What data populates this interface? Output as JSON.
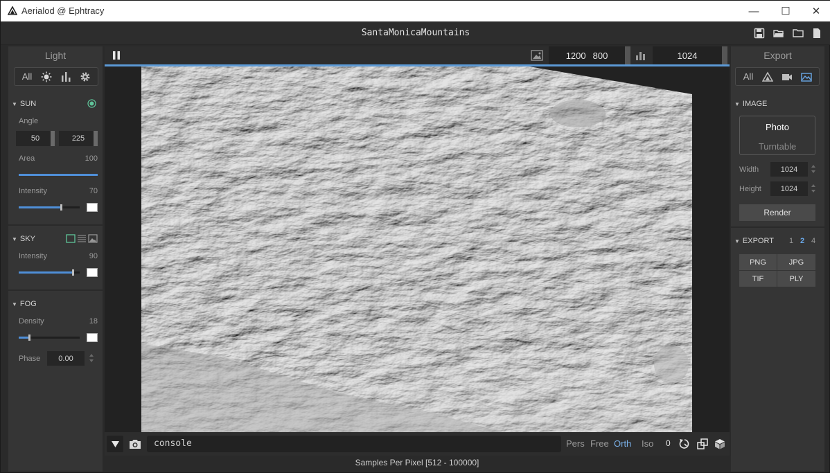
{
  "window": {
    "title": "Aerialod @ Ephtracy",
    "minimize_glyph": "—",
    "maximize_glyph": "☐",
    "close_glyph": "✕"
  },
  "app": {
    "document_title": "SantaMonicaMountains",
    "header_icons": [
      "save-icon",
      "open-folder-icon",
      "folder-icon",
      "file-icon"
    ]
  },
  "light_panel": {
    "title": "Light",
    "tabs": [
      {
        "label": "All",
        "icon": null
      },
      {
        "label": "",
        "icon": "sun-icon"
      },
      {
        "label": "",
        "icon": "bar-chart-icon"
      },
      {
        "label": "",
        "icon": "gear-icon"
      }
    ],
    "sun": {
      "header": "SUN",
      "angle_label": "Angle",
      "angle_a": "50",
      "angle_b": "225",
      "area_label": "Area",
      "area_value": "100",
      "area_fraction": 1.0,
      "intensity_label": "Intensity",
      "intensity_value": "70",
      "intensity_fraction": 0.7,
      "color": "#ffffff"
    },
    "sky": {
      "header": "SKY",
      "intensity_label": "Intensity",
      "intensity_value": "90",
      "intensity_fraction": 0.9,
      "color": "#ffffff"
    },
    "fog": {
      "header": "FOG",
      "density_label": "Density",
      "density_value": "18",
      "density_fraction": 0.18,
      "color": "#ffffff",
      "phase_label": "Phase",
      "phase_value": "0.00"
    }
  },
  "viewport": {
    "width_value": "1200",
    "height_value": "800",
    "samples_value": "1024",
    "status_text": "Samples Per Pixel [512 - 100000]",
    "console_text": "console",
    "camera_modes": [
      "Pers",
      "Free",
      "Orth",
      "Iso"
    ],
    "active_camera_mode": "Orth",
    "step_value": "0"
  },
  "export_panel": {
    "title": "Export",
    "tabs": [
      {
        "label": "All",
        "icon": null
      },
      {
        "label": "",
        "icon": "mountain-icon"
      },
      {
        "label": "",
        "icon": "video-icon"
      },
      {
        "label": "",
        "icon": "image-icon"
      }
    ],
    "image": {
      "header": "IMAGE",
      "mode_photo": "Photo",
      "mode_turntable": "Turntable",
      "width_label": "Width",
      "width_value": "1024",
      "height_label": "Height",
      "height_value": "1024",
      "render_label": "Render"
    },
    "export": {
      "header": "EXPORT",
      "scale_options": [
        "1",
        "2",
        "4"
      ],
      "active_scale": "2",
      "formats": [
        "PNG",
        "JPG",
        "TIF",
        "PLY"
      ]
    }
  },
  "colors": {
    "accent": "#5c9ad6",
    "slider_fill": "#4f8fd8",
    "sun_indicator": "#5fc59a",
    "sky_indicator": "#5fc59a"
  }
}
